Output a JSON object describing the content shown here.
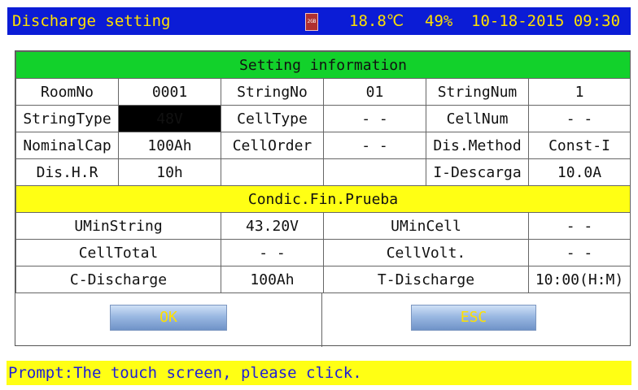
{
  "titlebar": {
    "title": "Discharge setting",
    "sd_icon_text": "2GB",
    "temperature": "18.8℃",
    "battery": "49%",
    "datetime": "10-18-2015 09:30"
  },
  "setting_info": {
    "header": "Setting information",
    "rows": [
      [
        "RoomNo",
        "0001",
        "StringNo",
        "01",
        "StringNum",
        "1"
      ],
      [
        "StringType",
        "48V",
        "CellType",
        "- -",
        "CellNum",
        "- -"
      ],
      [
        "NominalCap",
        "100Ah",
        "CellOrder",
        "- -",
        "Dis.Method",
        "Const-I"
      ],
      [
        "Dis.H.R",
        "10h",
        "",
        "",
        "I-Descarga",
        "10.0A"
      ]
    ]
  },
  "end_conditions": {
    "header": "Condic.Fin.Prueba",
    "rows": [
      [
        "UMinString",
        "43.20V",
        "UMinCell",
        "- -"
      ],
      [
        "CellTotal",
        "- -",
        "CellVolt.",
        "- -"
      ],
      [
        "C-Discharge",
        "100Ah",
        "T-Discharge",
        "10:00(H:M)"
      ]
    ]
  },
  "buttons": {
    "ok": "OK",
    "esc": "ESC"
  },
  "prompt": "Prompt:The touch screen, please click.",
  "colors": {
    "titlebar_bg": "#0b1cd6",
    "title_text": "#ffe000",
    "green_header": "#12d12b",
    "yellow_header": "#ffff14",
    "value_text": "#1a2bd6"
  }
}
